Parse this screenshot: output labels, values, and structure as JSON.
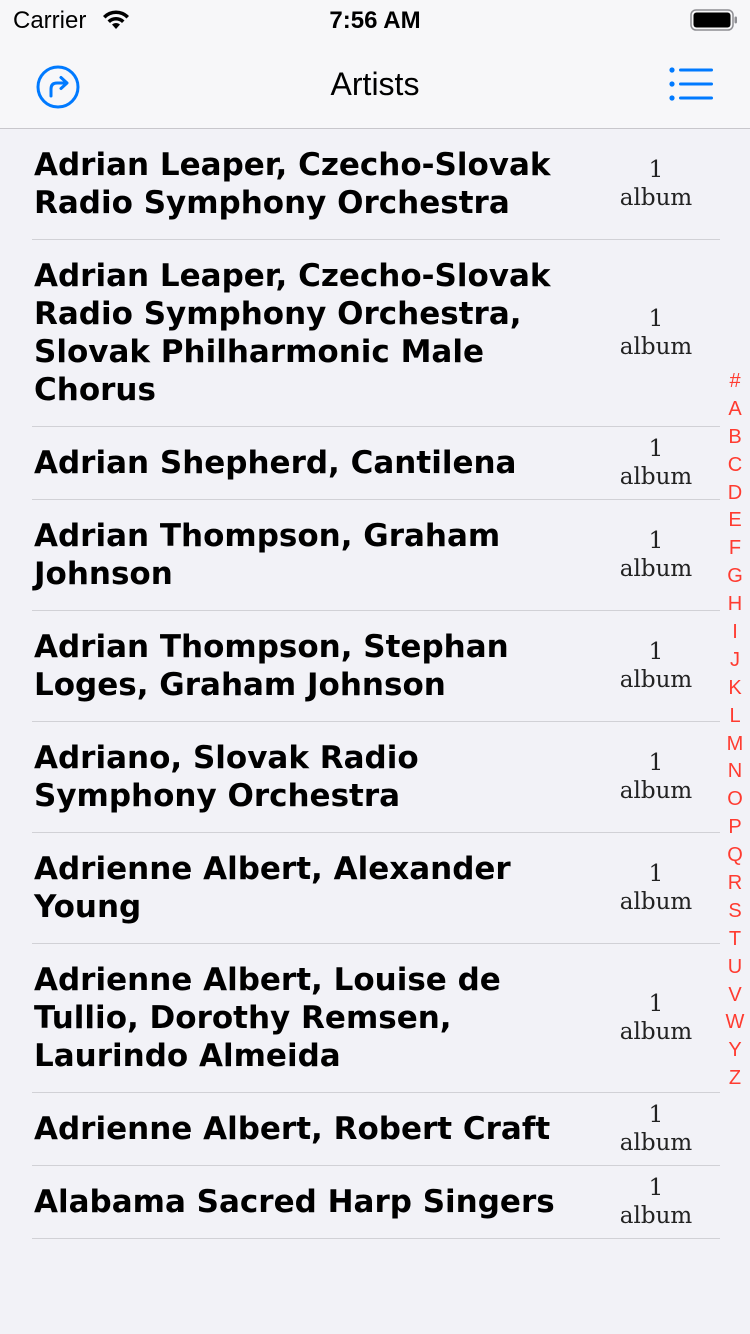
{
  "status_bar": {
    "carrier": "Carrier",
    "time": "7:56 AM"
  },
  "nav": {
    "title": "Artists",
    "left_icon": "forward-arrow-circle-icon",
    "right_icon": "list-icon",
    "accent_color": "#007aff"
  },
  "artists": [
    {
      "name": "Adrian Leaper, Czecho-Slovak Radio Symphony Orchestra",
      "count": "1",
      "unit": "album"
    },
    {
      "name": "Adrian Leaper, Czecho-Slovak Radio Symphony Orchestra, Slovak Philharmonic Male Chorus",
      "count": "1",
      "unit": "album"
    },
    {
      "name": "Adrian Shepherd, Cantilena",
      "count": "1",
      "unit": "album"
    },
    {
      "name": "Adrian Thompson, Graham Johnson",
      "count": "1",
      "unit": "album"
    },
    {
      "name": "Adrian Thompson, Stephan Loges, Graham Johnson",
      "count": "1",
      "unit": "album"
    },
    {
      "name": "Adriano, Slovak Radio Symphony Orchestra",
      "count": "1",
      "unit": "album"
    },
    {
      "name": "Adrienne Albert, Alexander Young",
      "count": "1",
      "unit": "album"
    },
    {
      "name": "Adrienne Albert, Louise de Tullio, Dorothy Remsen, Laurindo Almeida",
      "count": "1",
      "unit": "album"
    },
    {
      "name": "Adrienne Albert, Robert Craft",
      "count": "1",
      "unit": "album"
    },
    {
      "name": "Alabama Sacred Harp Singers",
      "count": "1",
      "unit": "album"
    }
  ],
  "section_index": [
    "#",
    "A",
    "B",
    "C",
    "D",
    "E",
    "F",
    "G",
    "H",
    "I",
    "J",
    "K",
    "L",
    "M",
    "N",
    "O",
    "P",
    "Q",
    "R",
    "S",
    "T",
    "U",
    "V",
    "W",
    "Y",
    "Z"
  ],
  "index_color": "#ff3b30"
}
